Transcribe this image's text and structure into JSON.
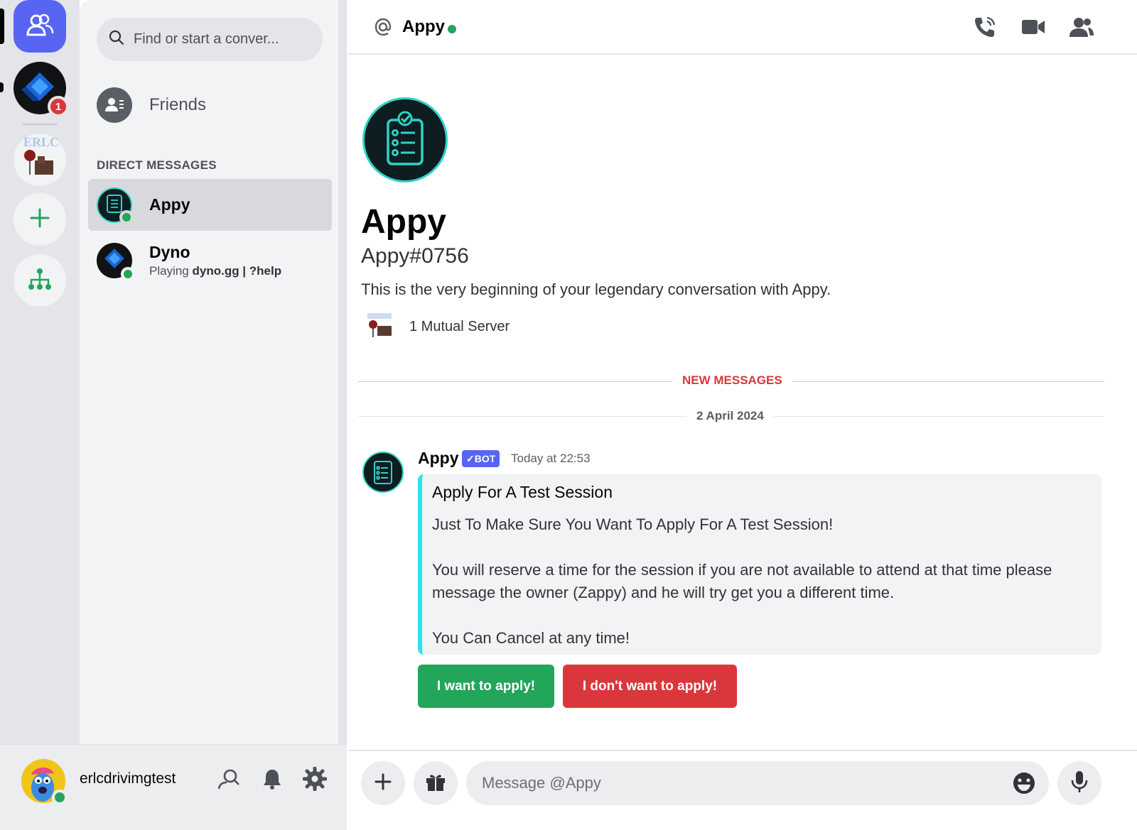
{
  "servers": {
    "home_icon": "friends-home-icon",
    "dyno_badge": "1",
    "erlc_label": "ERLC",
    "add_icon": "plus-icon",
    "discover_icon": "hierarchy-icon"
  },
  "dm_panel": {
    "search_placeholder": "Find or start a conver...",
    "friends_label": "Friends",
    "section_title": "DIRECT MESSAGES",
    "items": [
      {
        "name": "Appy",
        "status": "online",
        "activity": ""
      },
      {
        "name": "Dyno",
        "status": "online",
        "activity_prefix": "Playing ",
        "activity_bold": "dyno.gg | ?help"
      }
    ]
  },
  "user_bar": {
    "username": "erlcdrivimgtest",
    "status": "online"
  },
  "header": {
    "channel_name": "Appy",
    "status": "online"
  },
  "welcome": {
    "title": "Appy",
    "tag": "Appy#0756",
    "description": "This is the very beginning of your legendary conversation with Appy.",
    "mutual_servers": "1 Mutual Server"
  },
  "dividers": {
    "new_messages": "NEW MESSAGES",
    "date": "2 April 2024"
  },
  "message": {
    "author": "Appy",
    "badge": "✓BOT",
    "timestamp": "Today at 22:53",
    "embed": {
      "title": "Apply For A Test Session",
      "body": "Just To Make Sure You Want To Apply For A Test Session!\n\nYou will reserve a time for the session if you are not available to attend at that time please message the owner (Zappy) and he will try get you a different time.\n\nYou Can Cancel at any time!",
      "accent_color": "#2de3ef"
    },
    "buttons": {
      "apply": "I want to apply!",
      "decline": "I don't want to apply!"
    }
  },
  "composer": {
    "placeholder": "Message @Appy"
  },
  "colors": {
    "blurple": "#5865f2",
    "online": "#23a55a",
    "danger": "#da373c"
  }
}
